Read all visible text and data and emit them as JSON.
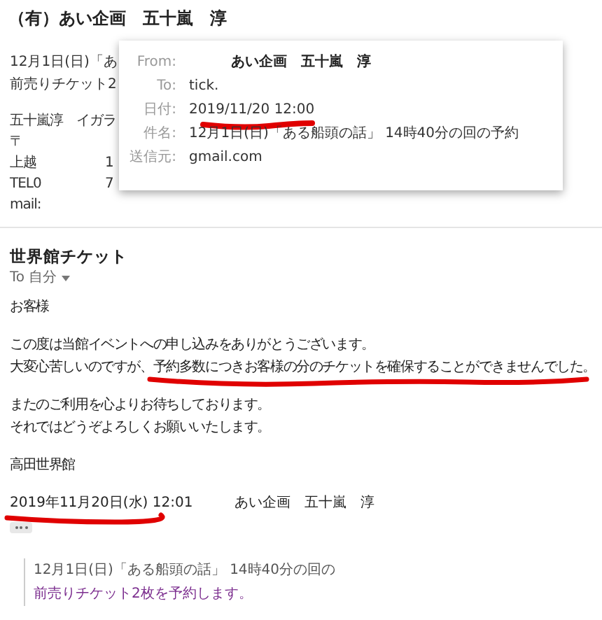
{
  "sender_heading": "（有）あい企画　五十嵐　淳",
  "quoted_preview": {
    "lines": [
      "12月1日(日)「あ",
      "前売りチケット2"
    ],
    "signature": [
      {
        "column_1": "五十嵐淳　イガラ"
      },
      {
        "column_1": "〒"
      },
      {
        "column_1": "上越",
        "column_2": "1"
      },
      {
        "column_1": "TEL0",
        "column_2": "7"
      },
      {
        "column_1": "mail:"
      }
    ]
  },
  "details_popup": {
    "fields": [
      {
        "label": "From:",
        "value": "あい企画　五十嵐　淳",
        "bold": true
      },
      {
        "label": "To:",
        "value": "tick.",
        "bold": false
      },
      {
        "label": "日付:",
        "value": "2019/11/20 12:00",
        "bold": false,
        "underlined": true
      },
      {
        "label": "件名:",
        "value": "12月1日(日)「ある船頭の話」 14時40分の回の予約",
        "bold": false
      },
      {
        "label": "送信元:",
        "value": "gmail.com",
        "bold": false
      }
    ]
  },
  "message": {
    "sender": "世界館チケット",
    "recipient": "To 自分",
    "body": [
      [
        "お客様"
      ],
      [
        "この度は当館イベントへの申し込みをありがとうございます。",
        "大変心苦しいのですが、予約多数につきお客様の分のチケットを確保することができませんでした。"
      ],
      [
        "またのご利用を心よりお待ちしております。",
        "それではどうぞよろしくお願いいたします。"
      ],
      [
        "高田世界館"
      ]
    ],
    "quote_header": {
      "date": "2019年11月20日(水) 12:01",
      "from": "あい企画　五十嵐　淳"
    },
    "quoted": [
      "12月1日(日)「ある船頭の話」 14時40分の回の",
      "前売りチケット2枚を予約します。"
    ]
  }
}
